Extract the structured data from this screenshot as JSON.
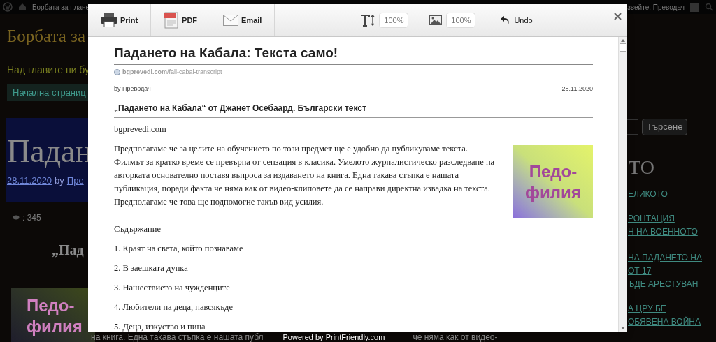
{
  "background": {
    "admin_bar": {
      "site": "Борбата за плане",
      "greeting": "звейте, Преводач"
    },
    "site_title": "Борбата за",
    "tagline": "Над главите ни бу",
    "nav_item": "Начална страниц",
    "post": {
      "title": "Падан",
      "date": "28.11.2020",
      "by": "by",
      "author": "Пре",
      "views": ": 345",
      "quote": "„Пад",
      "image_text": "Педо-филия"
    },
    "sidebar": {
      "search_button": "Търсене",
      "heading": "ТО",
      "links": [
        "ЕЛИКОТО",
        "РОНТАЦИЯ",
        "Н НА ВОЕННОТО",
        "НА ПАДАНЕТО НА",
        "ОТ 17",
        "ЪДЕ АРЕСТУВАН",
        "А ЦРУ БЕ",
        "ОБЯВЕНА ВОЙНА"
      ]
    },
    "bottom_line": [
      "на книга. Една такава стъпка е нашата публ",
      "че няма как от видео-"
    ]
  },
  "dialog": {
    "toolbar": [
      {
        "kind": "print",
        "label": "Print"
      },
      {
        "kind": "pdf",
        "label": "PDF"
      },
      {
        "kind": "email",
        "label": "Email"
      }
    ],
    "text_size": "100%",
    "image_size": "100%",
    "undo": "Undo",
    "article": {
      "title": "Падането на Кабала: Текста само!",
      "source_domain": "bgprevedi.com",
      "source_path": "/fall-cabal-transcript",
      "byline": "by Преводач",
      "date": "28.11.2020",
      "subtitle": "„Падането на Кабала“ от Джанет Осебаард. Български текст",
      "site_line": "bgprevedi.com",
      "intro": "Предполагаме че за целите на обучението по този предмет ще е удобно да публикуваме текста. Филмът за кратко време се превърна от сензация в класика. Умелото журналистическо разследване на авторката основателно поставя въпроса за издаването на книга. Една такава стъпка е нашата публикация, поради факта че няма как от видео-клиповете да се направи директна извадка на текста. Предполагаме че това ще подпомогне такъв вид усилия.",
      "image_text": "Педо-филия",
      "contents_heading": "Съдържание",
      "contents": [
        "1. Краят на света, който познаваме",
        "2. В заешката дупка",
        "3. Нашествието на чужденците",
        "4. Любители на деца, навсякъде",
        "5. Деца, изкуство и пица"
      ]
    },
    "footer": "Powered by PrintFriendly.com"
  }
}
